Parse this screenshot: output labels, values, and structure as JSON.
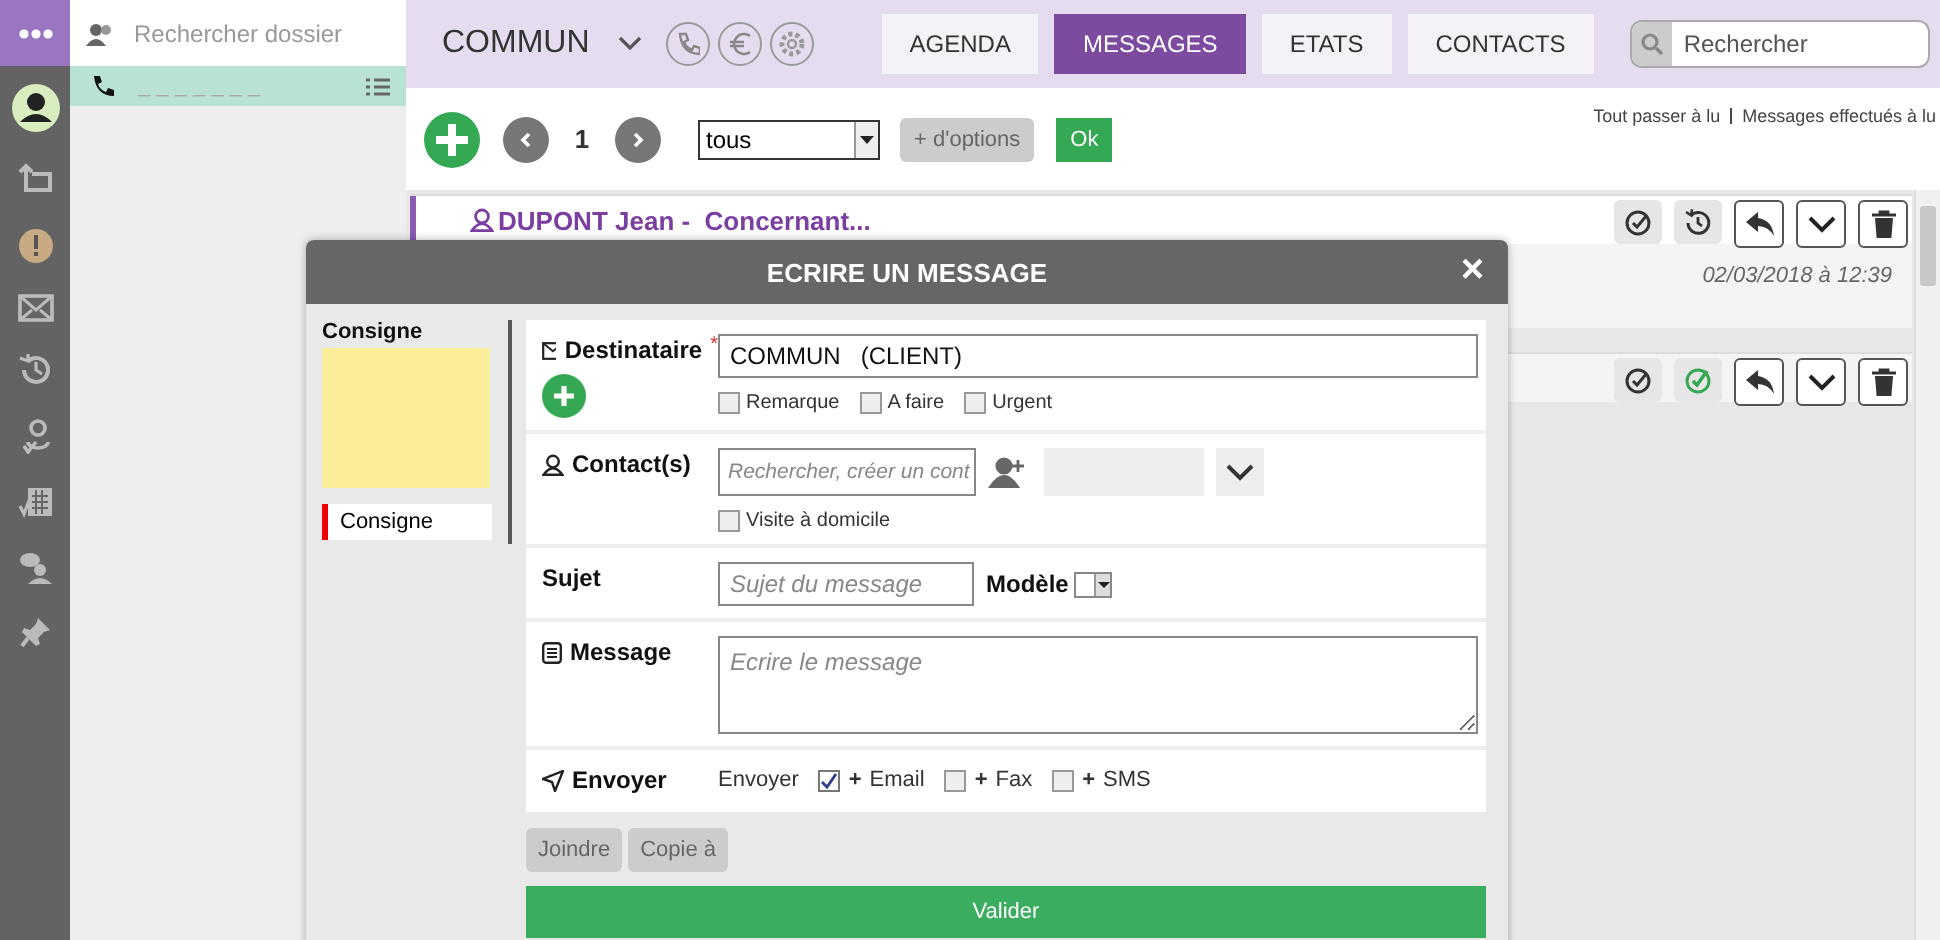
{
  "folder_panel": {
    "search": {
      "placeholder": "Rechercher dossier"
    },
    "items": [
      {
        "number": "_ _ _ _ _ _ _",
        "selected": true
      }
    ]
  },
  "header": {
    "account": "COMMUN",
    "tabs": [
      {
        "label": "AGENDA",
        "selected": false
      },
      {
        "label": "MESSAGES",
        "selected": true
      },
      {
        "label": "ETATS",
        "selected": false
      },
      {
        "label": "CONTACTS",
        "selected": false
      }
    ],
    "search": {
      "placeholder": "Rechercher"
    }
  },
  "toolbar": {
    "page": "1",
    "filter": "tous",
    "more_button": "+ d'options",
    "ok_button": "Ok",
    "links": [
      "Tout passer à lu",
      "Messages effectués à lu"
    ]
  },
  "messages": [
    {
      "title": "DUPONT Jean -  Concernant...",
      "date": "02/03/2018 à 12:39",
      "done": false
    },
    {
      "done": true
    }
  ],
  "dialog": {
    "title": "ECRIRE UN MESSAGE",
    "close": "×",
    "side": {
      "heading": "Consigne",
      "tabs": [
        {
          "label": "Consigne",
          "selected": true
        }
      ]
    },
    "recipient": {
      "label": "Destinataire",
      "required": "*",
      "value": "COMMUN   (CLIENT)",
      "flags": [
        {
          "label": "Remarque",
          "checked": false
        },
        {
          "label": "A faire",
          "checked": false
        },
        {
          "label": "Urgent",
          "checked": false
        }
      ]
    },
    "contact": {
      "label": "Contact(s)",
      "placeholder": "Rechercher, créer un cont",
      "home_visit": {
        "label": "Visite à domicile",
        "checked": false
      }
    },
    "subject": {
      "label": "Sujet",
      "placeholder": "Sujet du message",
      "template_label": "Modèle"
    },
    "message": {
      "label": "Message",
      "placeholder": "Ecrire le message"
    },
    "send": {
      "label": "Envoyer",
      "prefix": "Envoyer",
      "channels": [
        {
          "label": "**+** Email",
          "checked": true
        },
        {
          "label": "**+** Fax",
          "checked": false
        },
        {
          "label": "**+** SMS",
          "checked": false
        }
      ]
    },
    "buttons": [
      "Joindre",
      "Copie à"
    ],
    "submit": "Valider"
  }
}
